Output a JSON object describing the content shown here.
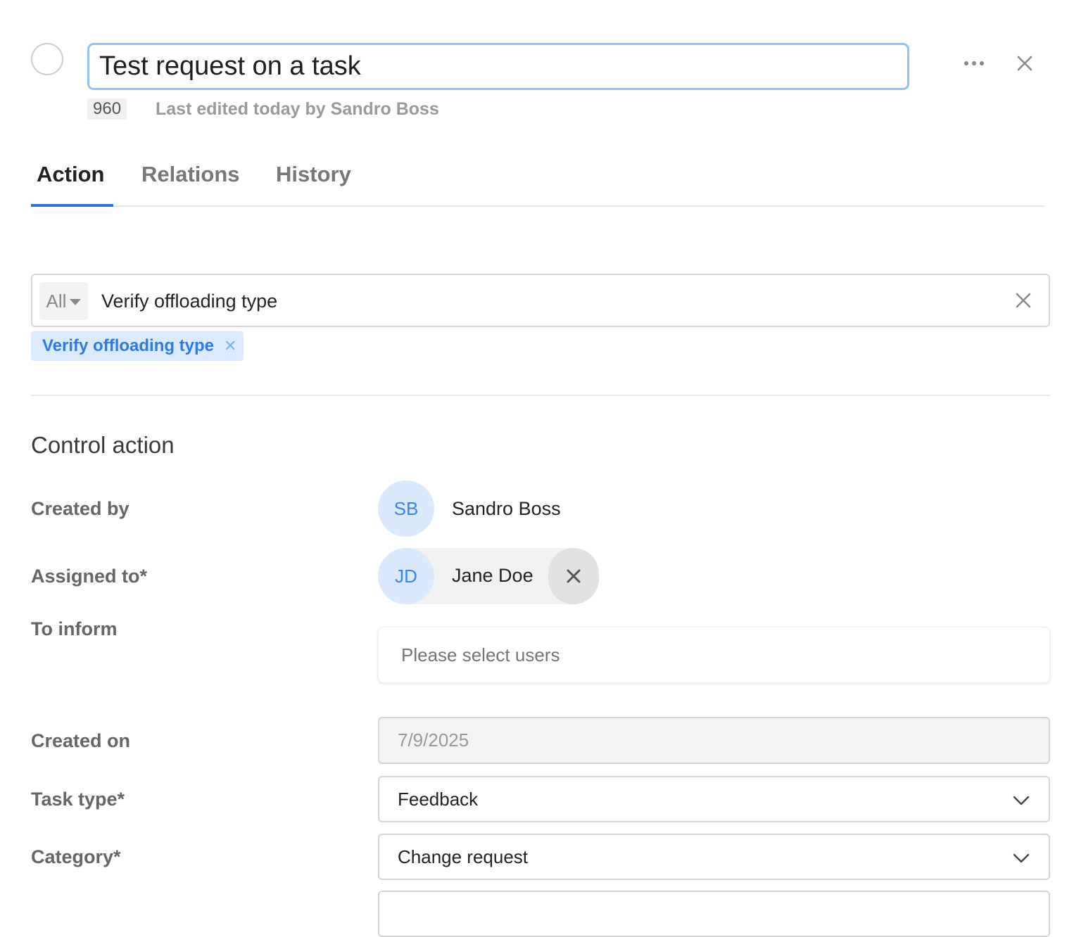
{
  "header": {
    "title_value": "Test request on a task",
    "id": "960",
    "last_edited": "Last edited today by Sandro Boss"
  },
  "tabs": [
    {
      "label": "Action",
      "active": true
    },
    {
      "label": "Relations",
      "active": false
    },
    {
      "label": "History",
      "active": false
    }
  ],
  "search": {
    "scope": "All",
    "value": "Verify offloading type",
    "chips": [
      {
        "label": "Verify offloading type"
      }
    ]
  },
  "section": {
    "title": "Control action"
  },
  "fields": {
    "created_by": {
      "label": "Created by",
      "initials": "SB",
      "name": "Sandro Boss"
    },
    "assigned_to": {
      "label": "Assigned to*",
      "initials": "JD",
      "name": "Jane Doe"
    },
    "to_inform": {
      "label": "To inform",
      "placeholder": "Please select users"
    },
    "created_on": {
      "label": "Created on",
      "value": "7/9/2025"
    },
    "task_type": {
      "label": "Task type*",
      "value": "Feedback"
    },
    "category": {
      "label": "Category*",
      "value": "Change request"
    }
  },
  "colors": {
    "accent": "#2b72d6",
    "chip_bg": "#dbeafe",
    "avatar_bg": "#dbe9fd",
    "focus_border": "#92c2f3"
  },
  "icons": {
    "more": "more-horizontal-icon",
    "close": "close-icon",
    "caret": "caret-down-icon",
    "chevron": "chevron-down-icon"
  }
}
